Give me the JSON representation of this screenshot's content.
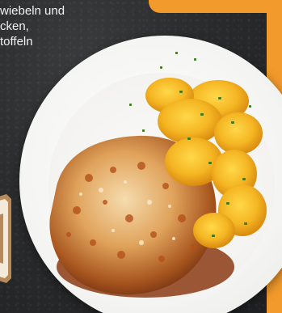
{
  "caption": {
    "line1": "wiebeln und",
    "line2": "cken,",
    "line3": "toffeln"
  },
  "colors": {
    "accent": "#f39a2c",
    "background": "#2a2b2d",
    "plate": "#f4f4f2",
    "text": "#f2f2f2"
  },
  "image": {
    "subject_icon": "dish-photo"
  }
}
